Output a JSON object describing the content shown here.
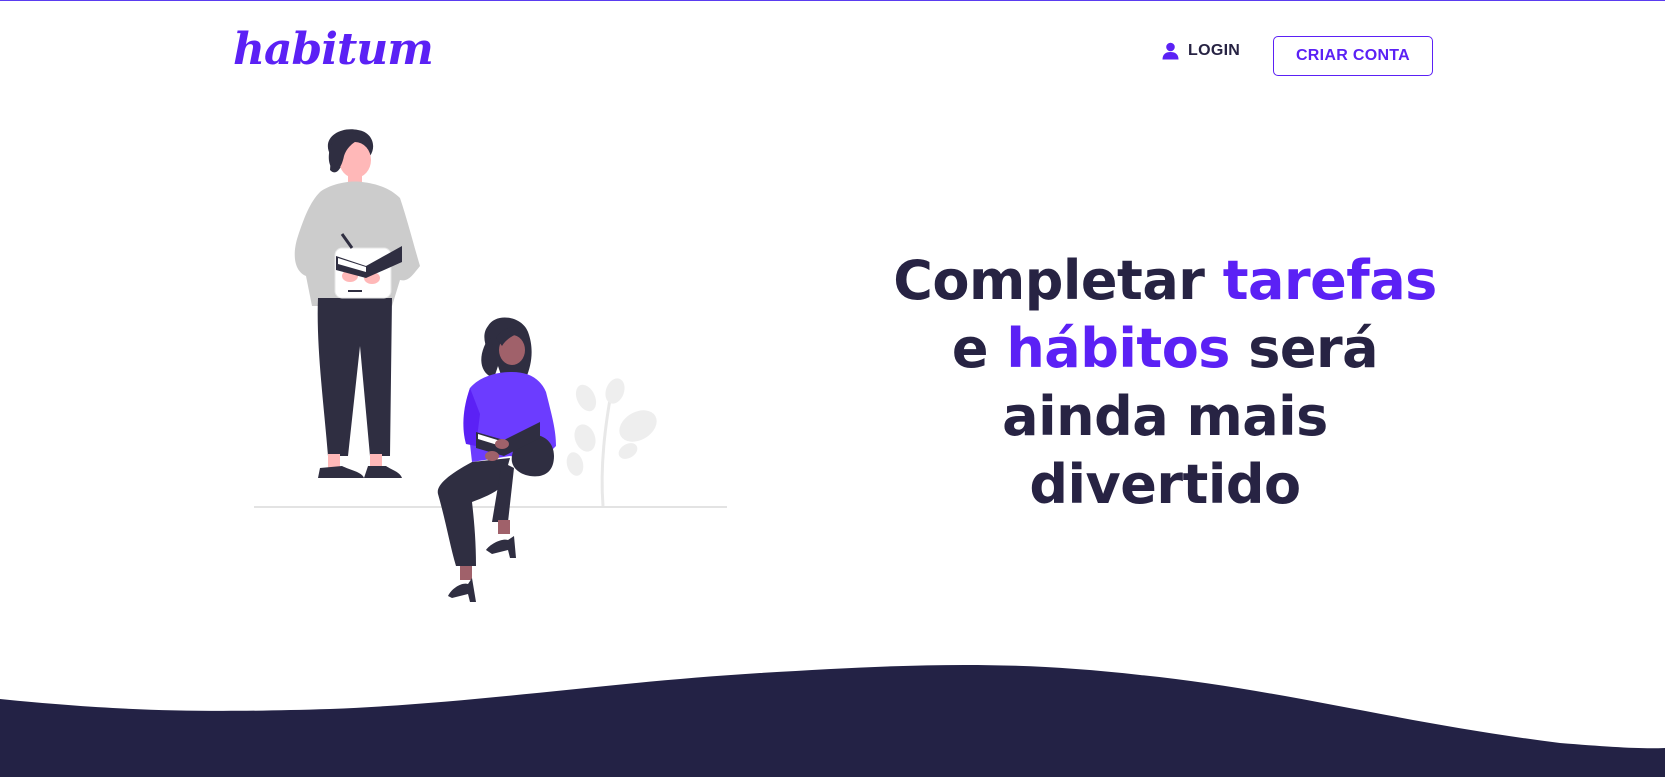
{
  "brand": {
    "name": "habitum",
    "accent": "#5b21f5",
    "dark": "#272343"
  },
  "nav": {
    "login_label": "LOGIN",
    "login_icon": "user-icon",
    "signup_label": "CRIAR CONTA"
  },
  "hero": {
    "title_parts": [
      "Completar ",
      "tarefas",
      "e ",
      "hábitos",
      " será",
      "ainda mais",
      "divertido"
    ],
    "illustration": "people-reading-illustration"
  }
}
